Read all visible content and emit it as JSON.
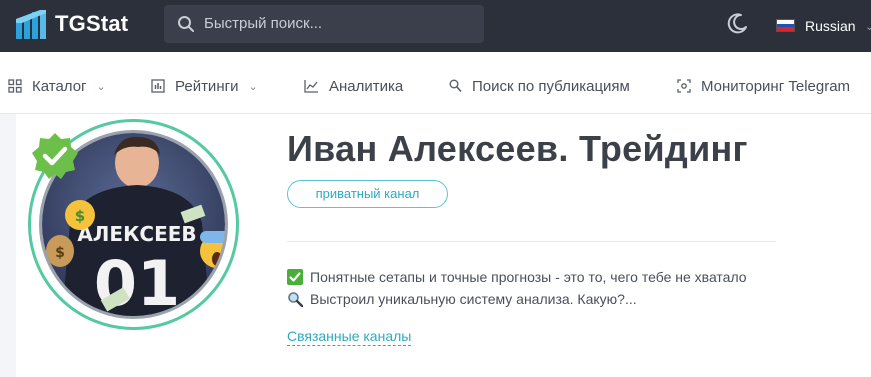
{
  "header": {
    "logo_text": "TGStat",
    "search_placeholder": "Быстрый поиск...",
    "language": "Russian",
    "icons": [
      "logo-icon",
      "search-icon",
      "moon-icon",
      "russia-flag-icon",
      "chevron-down-icon"
    ]
  },
  "nav": {
    "items": [
      {
        "label": "Каталог",
        "icon": "grid-icon",
        "dropdown": true
      },
      {
        "label": "Рейтинги",
        "icon": "bar-chart-icon",
        "dropdown": true
      },
      {
        "label": "Аналитика",
        "icon": "line-chart-icon",
        "dropdown": false
      },
      {
        "label": "Поиск по публикациям",
        "icon": "search-icon",
        "dropdown": false
      },
      {
        "label": "Мониторинг Telegram",
        "icon": "monitor-icon",
        "dropdown": false
      }
    ]
  },
  "channel": {
    "title": "Иван Алексеев. Трейдинг",
    "badge": "приватный канал",
    "verified": true,
    "avatar_shirt_name": "АЛЕКСЕЕВ",
    "avatar_shirt_number": "01",
    "description": [
      {
        "emoji": "check-mark-emoji",
        "text": "Понятные сетапы и точные прогнозы - это то, чего тебе не хватало"
      },
      {
        "emoji": "magnifier-emoji",
        "text": "Выстроил уникальную систему анализа. Какую?..."
      }
    ],
    "related_link": "Связанные каналы"
  },
  "colors": {
    "header_bg": "#2c303b",
    "accent": "#2fa9c2",
    "verified_green": "#6cc04a",
    "avatar_ring": "#55c9a0"
  }
}
